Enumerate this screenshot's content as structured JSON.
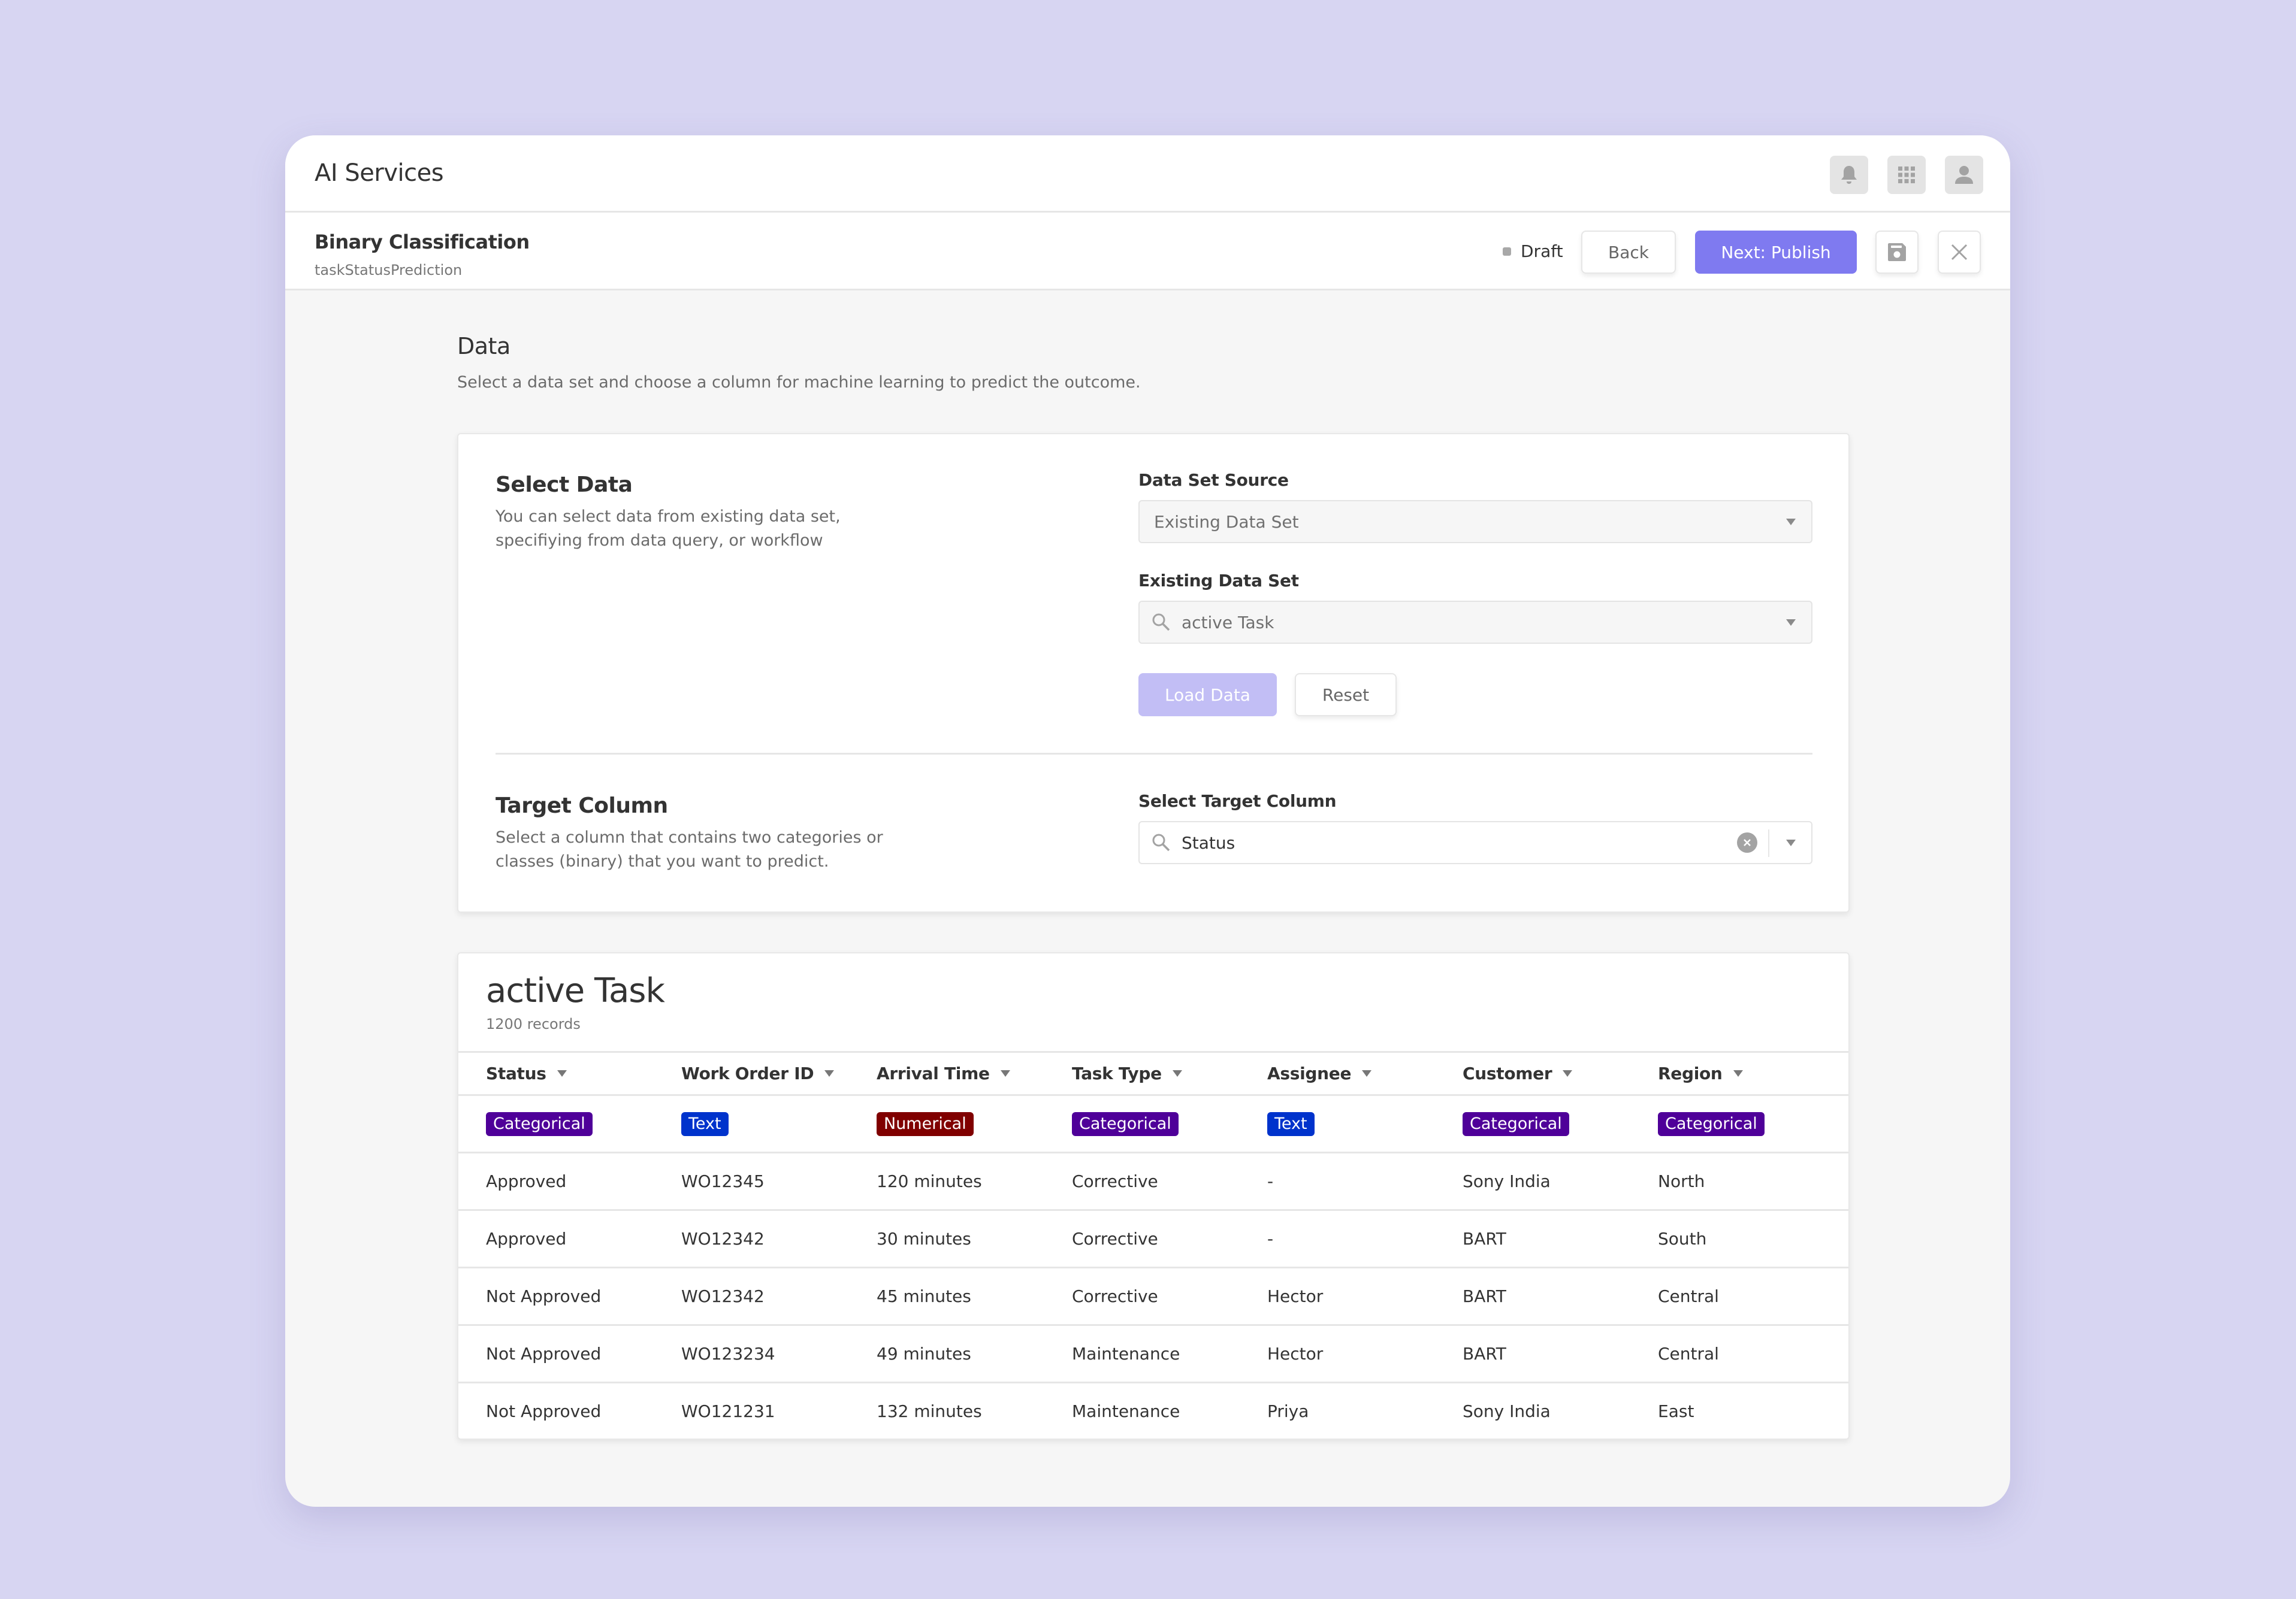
{
  "app": {
    "title": "AI Services",
    "header_icons": [
      "bell-icon",
      "apps-grid-icon",
      "user-icon"
    ]
  },
  "subheader": {
    "title": "Binary Classification",
    "subtitle": "taskStatusPrediction",
    "status": "Draft",
    "back_label": "Back",
    "next_label": "Next: Publish"
  },
  "page": {
    "title": "Data",
    "description": "Select a data set and choose a column for machine learning to predict the outcome."
  },
  "select_data": {
    "title": "Select Data",
    "description": "You can select data from existing data set, specifiying from data query, or workflow",
    "source_label": "Data Set Source",
    "source_value": "Existing Data Set",
    "existing_label": "Existing Data Set",
    "existing_value": "active Task",
    "load_label": "Load Data",
    "reset_label": "Reset"
  },
  "target_column": {
    "title": "Target Column",
    "description": "Select a column that contains two categories or classes (binary) that you want to predict.",
    "label": "Select Target Column",
    "value": "Status"
  },
  "dataset": {
    "title": "active Task",
    "records": "1200 records",
    "columns": [
      {
        "name": "Status",
        "type": "Categorical"
      },
      {
        "name": "Work Order ID",
        "type": "Text"
      },
      {
        "name": "Arrival Time",
        "type": "Numerical"
      },
      {
        "name": "Task Type",
        "type": "Categorical"
      },
      {
        "name": "Assignee",
        "type": "Text"
      },
      {
        "name": "Customer",
        "type": "Categorical"
      },
      {
        "name": "Region",
        "type": "Categorical"
      }
    ],
    "type_colors": {
      "Categorical": "#4f0099",
      "Text": "#0033cc",
      "Numerical": "#800000"
    },
    "rows": [
      [
        "Approved",
        "WO12345",
        "120 minutes",
        "Corrective",
        "-",
        "Sony India",
        "North"
      ],
      [
        "Approved",
        "WO12342",
        "30 minutes",
        "Corrective",
        "-",
        "BART",
        "South"
      ],
      [
        "Not Approved",
        "WO12342",
        "45 minutes",
        "Corrective",
        "Hector",
        "BART",
        "Central"
      ],
      [
        "Not Approved",
        "WO123234",
        "49 minutes",
        "Maintenance",
        "Hector",
        "BART",
        "Central"
      ],
      [
        "Not Approved",
        "WO121231",
        "132 minutes",
        "Maintenance",
        "Priya",
        "Sony India",
        "East"
      ]
    ]
  },
  "colors": {
    "accent": "#7f7af0",
    "accent_disabled": "#c2bef5",
    "background": "#d7d5f2"
  }
}
